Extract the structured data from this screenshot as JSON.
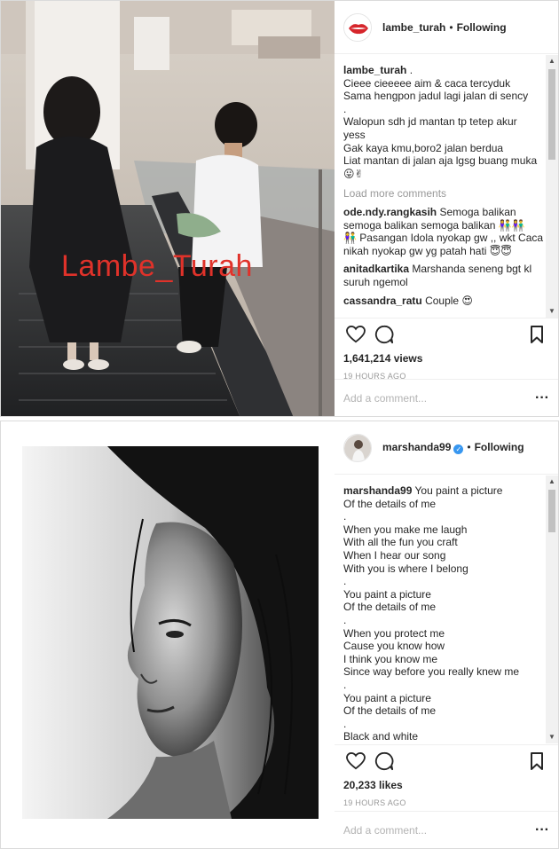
{
  "post1": {
    "username": "lambe_turah",
    "following": "Following",
    "watermark": "Lambe_Turah",
    "caption": {
      "username": "lambe_turah",
      "first": ".",
      "lines": [
        "Cieee cieeeee aim & caca tercyduk",
        "Sama hengpon jadul lagi jalan di sency",
        ".",
        "Walopun sdh jd mantan tp tetep akur",
        "yess",
        "Gak kaya kmu,boro2 jalan berdua",
        "Liat mantan di jalan aja lgsg buang muka",
        "😛✌"
      ]
    },
    "load_more": "Load more comments",
    "comments": [
      {
        "user": "ode.ndy.rangkasih",
        "text": "Semoga balikan semoga balikan semoga balikan 👫👫"
      },
      {
        "user": "",
        "text": "👫 Pasangan Idola nyokap gw ,, wkt Caca nikah nyokap gw yg patah hati 😇😇"
      },
      {
        "user": "anitadkartika",
        "text": "Marshanda seneng bgt kl suruh ngemol"
      },
      {
        "user": "cassandra_ratu",
        "text": "Couple 😍"
      }
    ],
    "views": "1,641,214 views",
    "time_ago": "19 HOURS AGO",
    "add_comment_placeholder": "Add a comment..."
  },
  "post2": {
    "username": "marshanda99",
    "following": "Following",
    "caption": {
      "username": "marshanda99",
      "first": "You paint a picture",
      "lines": [
        "Of the details of me",
        ".",
        "When you make me laugh",
        "With all the fun you craft",
        "When I hear our song",
        "With you is where I belong",
        ".",
        "You paint a picture",
        "Of the details of me",
        ".",
        "When you protect me",
        "Cause you know how",
        "I think you know me",
        "Since way before you really knew me",
        ".",
        "You paint a picture",
        "Of the details of me",
        ".",
        "Black and white"
      ]
    },
    "likes": "20,233 likes",
    "time_ago": "19 HOURS AGO",
    "add_comment_placeholder": "Add a comment..."
  },
  "colors": {
    "brand_red": "#e0322a",
    "verified_blue": "#3897f0",
    "muted_text": "#999999",
    "border": "#dbdbdb"
  },
  "icons": [
    "heart-icon",
    "comment-bubble-icon",
    "bookmark-icon",
    "more-dots-icon",
    "verified-badge-icon",
    "scroll-up-arrow-icon",
    "scroll-down-arrow-icon"
  ]
}
